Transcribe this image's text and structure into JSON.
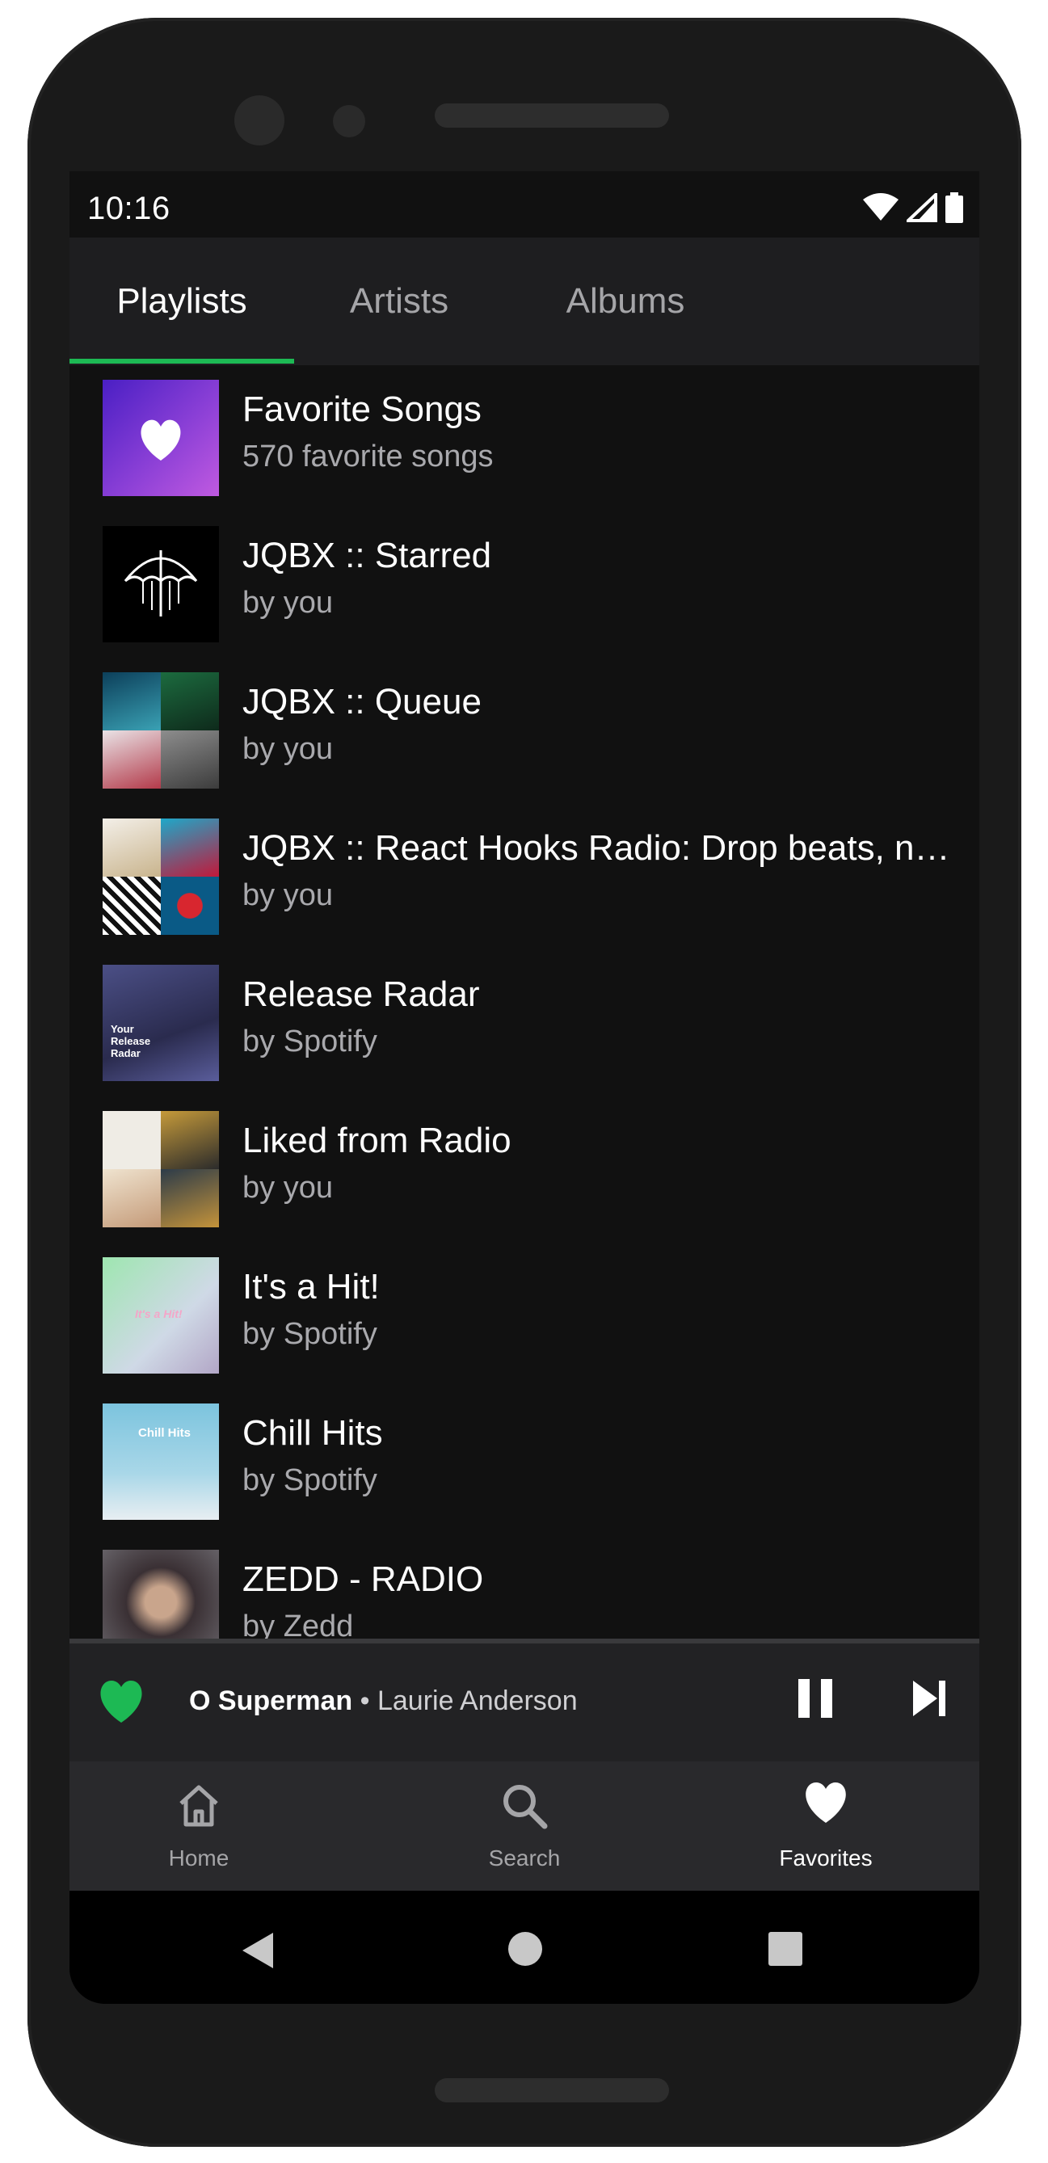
{
  "status_bar": {
    "time": "10:16",
    "icons": [
      "wifi-icon",
      "signal-icon",
      "battery-icon"
    ]
  },
  "tabs": [
    {
      "label": "Playlists",
      "active": true
    },
    {
      "label": "Artists",
      "active": false
    },
    {
      "label": "Albums",
      "active": false
    }
  ],
  "playlists": [
    {
      "title": "Favorite Songs",
      "subtitle": "570 favorite songs",
      "art": "heart-gradient"
    },
    {
      "title": "JQBX :: Starred",
      "subtitle": "by you",
      "art": "umbrella"
    },
    {
      "title": "JQBX :: Queue",
      "subtitle": "by you",
      "art": "mosaic"
    },
    {
      "title": "JQBX :: React Hooks Radio: Drop beats, n…",
      "subtitle": "by you",
      "art": "mosaic"
    },
    {
      "title": "Release Radar",
      "subtitle": "by Spotify",
      "art": "release-radar",
      "art_text": [
        "Your",
        "Release",
        "Radar"
      ]
    },
    {
      "title": "Liked from Radio",
      "subtitle": "by you",
      "art": "mosaic"
    },
    {
      "title": "It's a Hit!",
      "subtitle": "by Spotify",
      "art": "its-a-hit",
      "art_text": "It's a Hit!"
    },
    {
      "title": "Chill Hits",
      "subtitle": "by Spotify",
      "art": "chill-hits",
      "art_text": "Chill Hits"
    },
    {
      "title": "ZEDD - RADIO",
      "subtitle": "by Zedd",
      "art": "portrait"
    }
  ],
  "now_playing": {
    "song": "O Superman",
    "separator": " • ",
    "artist": "Laurie Anderson",
    "progress": 0.0,
    "liked": true
  },
  "bottom_nav": [
    {
      "label": "Home",
      "icon": "home-icon",
      "active": false
    },
    {
      "label": "Search",
      "icon": "search-icon",
      "active": false
    },
    {
      "label": "Favorites",
      "icon": "heart-icon",
      "active": true
    }
  ],
  "colors": {
    "accent": "#1db954",
    "background": "#111111",
    "tab_bar": "#1e1e20",
    "secondary_text": "#a9a9ad"
  }
}
